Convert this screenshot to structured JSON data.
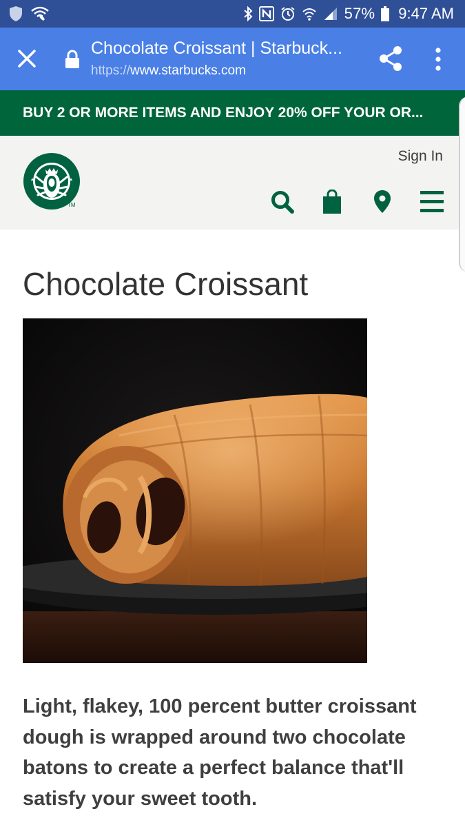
{
  "status_bar": {
    "battery": "57%",
    "time": "9:47 AM"
  },
  "browser": {
    "title": "Chocolate Croissant | Starbuck...",
    "url_scheme": "https://",
    "url_host": "www.starbucks.com",
    "theme_color": "#4a80e6"
  },
  "promo": {
    "text": "BUY 2 OR MORE ITEMS AND ENJOY 20% OFF YOUR OR...",
    "color": "#00653b"
  },
  "header": {
    "logo_tm": "TM",
    "sign_in": "Sign In",
    "brand_color": "#006241",
    "icons": [
      "search-icon",
      "bag-icon",
      "location-pin-icon",
      "hamburger-menu-icon"
    ]
  },
  "product": {
    "name": "Chocolate Croissant",
    "description": "Light, flakey, 100 percent butter croissant dough is wrapped around two chocolate batons to create a perfect balance that'll satisfy your sweet tooth."
  }
}
